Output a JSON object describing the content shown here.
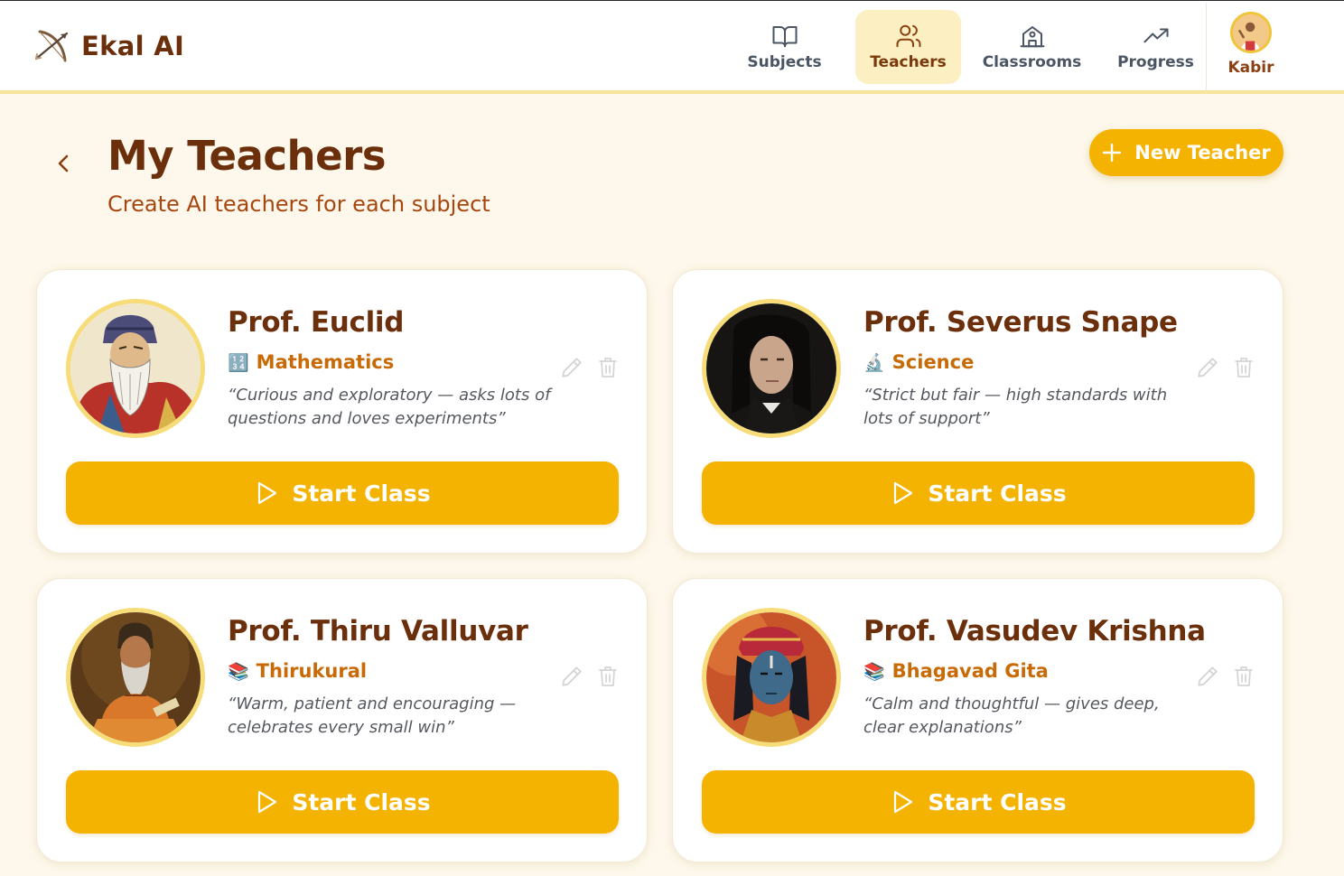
{
  "app": {
    "name": "Ekal AI",
    "logo_icon": "bow-arrow-icon"
  },
  "nav": {
    "items": [
      {
        "label": "Subjects",
        "icon": "book-open-icon",
        "active": false
      },
      {
        "label": "Teachers",
        "icon": "users-icon",
        "active": true
      },
      {
        "label": "Classrooms",
        "icon": "school-icon",
        "active": false
      },
      {
        "label": "Progress",
        "icon": "trending-up-icon",
        "active": false
      }
    ],
    "user": {
      "name": "Kabir",
      "avatar": "user-avatar"
    }
  },
  "page": {
    "title": "My Teachers",
    "subtitle": "Create AI teachers for each subject",
    "new_button": "New Teacher"
  },
  "teachers": [
    {
      "name": "Prof. Euclid",
      "subject_emoji": "🔢",
      "subject": "Mathematics",
      "quote": "“Curious and exploratory — asks lots of questions and loves experiments”",
      "start_label": "Start Class"
    },
    {
      "name": "Prof. Severus Snape",
      "subject_emoji": "🔬",
      "subject": "Science",
      "quote": "“Strict but fair — high standards with lots of support”",
      "start_label": "Start Class"
    },
    {
      "name": "Prof. Thiru Valluvar",
      "subject_emoji": "📚",
      "subject": "Thirukural",
      "quote": "“Warm, patient and encouraging — celebrates every small win”",
      "start_label": "Start Class"
    },
    {
      "name": "Prof. Vasudev Krishna",
      "subject_emoji": "📚",
      "subject": "Bhagavad Gita",
      "quote": "“Calm and thoughtful — gives deep, clear explanations”",
      "start_label": "Start Class"
    }
  ],
  "colors": {
    "accent": "#f5b301",
    "brand": "#6b2f0c",
    "subject": "#c86a06",
    "background": "#fdf8eb"
  }
}
